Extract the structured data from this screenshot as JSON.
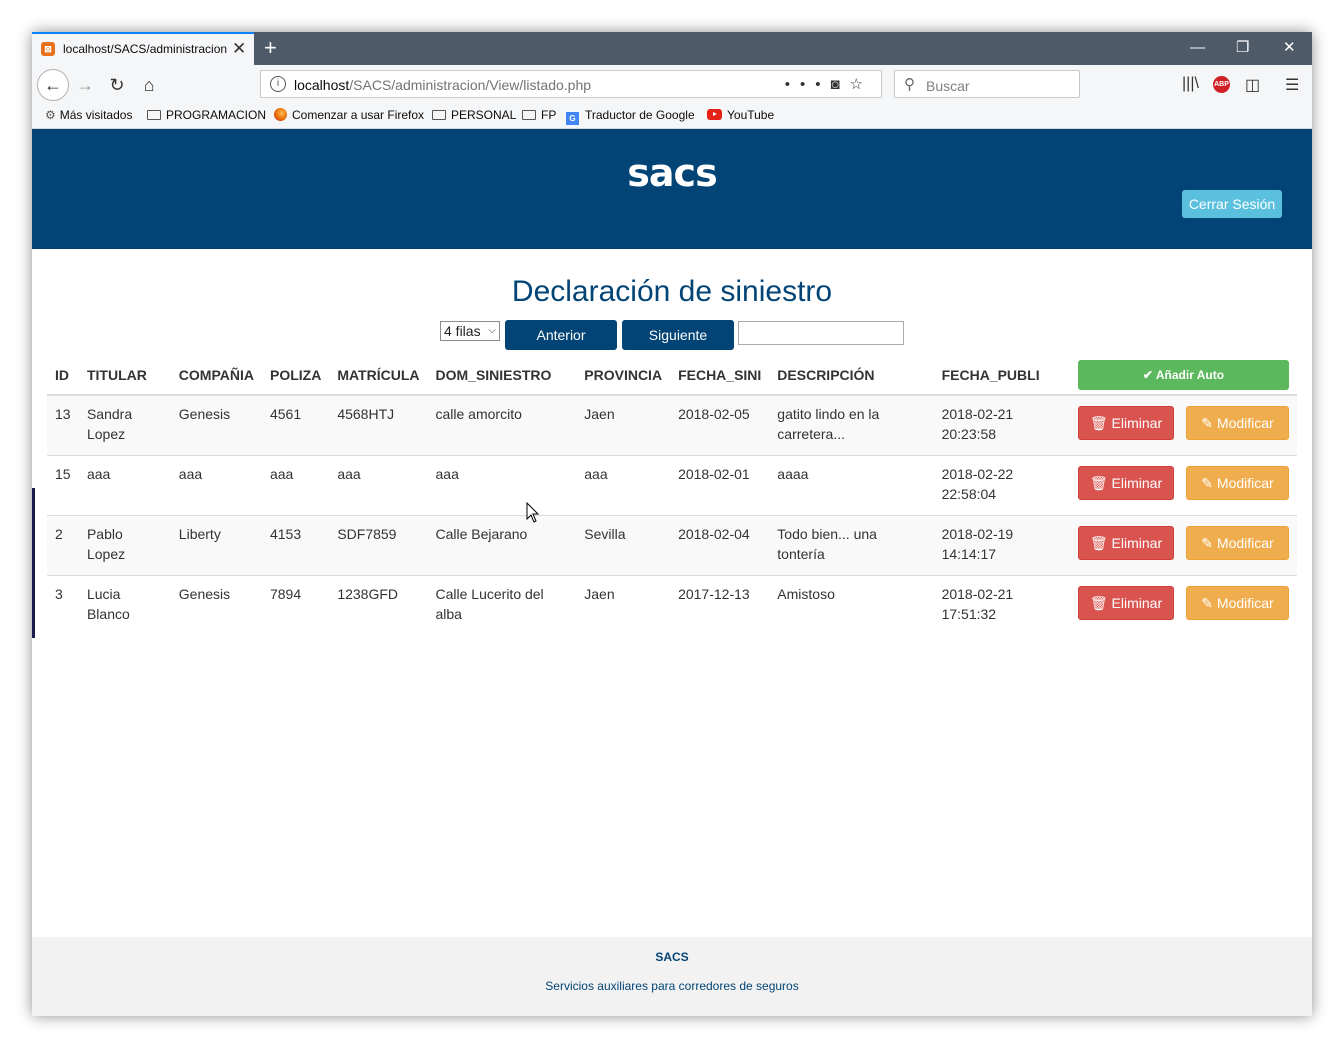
{
  "browser": {
    "tab_title": "localhost/SACS/administracion",
    "tab_favicon": "xampp-icon",
    "url_host": "localhost",
    "url_path": "/SACS/administracion/View/listado.php",
    "search_placeholder": "Buscar",
    "bookmarks": [
      {
        "label": "Más visitados",
        "icon": "gear-icon"
      },
      {
        "label": "PROGRAMACION",
        "icon": "folder-icon"
      },
      {
        "label": "Comenzar a usar Firefox",
        "icon": "firefox-icon"
      },
      {
        "label": "PERSONAL",
        "icon": "folder-icon"
      },
      {
        "label": "FP",
        "icon": "folder-icon"
      },
      {
        "label": "Traductor de Google",
        "icon": "google-translate-icon"
      },
      {
        "label": "YouTube",
        "icon": "youtube-icon"
      }
    ]
  },
  "header": {
    "logo": "sacs",
    "logout_label": "Cerrar Sesión"
  },
  "main": {
    "title": "Declaración de siniestro",
    "rows_select": "4 filas",
    "prev_label": "Anterior",
    "next_label": "Siguiente",
    "filter_value": "",
    "add_label": "Añadir Auto",
    "delete_label": "Eliminar",
    "modify_label": "Modificar",
    "columns": [
      "ID",
      "TITULAR",
      "COMPAÑIA",
      "POLIZA",
      "MATRÍCULA",
      "DOM_SINIESTRO",
      "PROVINCIA",
      "FECHA_SINI",
      "DESCRIPCIÓN",
      "FECHA_PUBLI"
    ],
    "rows": [
      [
        "13",
        "Sandra Lopez",
        "Genesis",
        "4561",
        "4568HTJ",
        "calle amorcito",
        "Jaen",
        "2018-02-05",
        "gatito lindo en la carretera...",
        "2018-02-21 20:23:58"
      ],
      [
        "15",
        "aaa",
        "aaa",
        "aaa",
        "aaa",
        "aaa",
        "aaa",
        "2018-02-01",
        "aaaa",
        "2018-02-22 22:58:04"
      ],
      [
        "2",
        "Pablo Lopez",
        "Liberty",
        "4153",
        "SDF7859",
        "Calle Bejarano",
        "Sevilla",
        "2018-02-04",
        "Todo bien... una tontería",
        "2018-02-19 14:14:17"
      ],
      [
        "3",
        "Lucia Blanco",
        "Genesis",
        "7894",
        "1238GFD",
        "Calle Lucerito del alba",
        "Jaen",
        "2017-12-13",
        "Amistoso",
        "2018-02-21 17:51:32"
      ]
    ]
  },
  "footer": {
    "brand": "SACS",
    "tagline": "Servicios auxiliares para corredores de seguros"
  },
  "colors": {
    "brand": "#024475",
    "danger": "#d9534f",
    "warning": "#f0ad4e",
    "success": "#5cb85c",
    "info": "#5bc0de"
  }
}
